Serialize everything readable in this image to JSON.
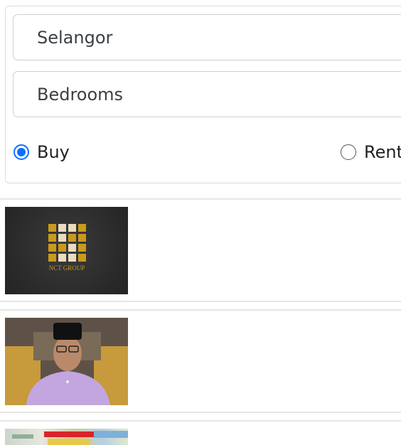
{
  "filters": {
    "region": {
      "value": "Selangor"
    },
    "bedrooms": {
      "value": "Bedrooms"
    },
    "listing_type": {
      "options": [
        {
          "label": "Buy",
          "checked": true
        },
        {
          "label": "Rent",
          "checked": false
        }
      ]
    }
  },
  "results": [
    {
      "image": "nct-group-logo",
      "logo_text": "NCT GROUP"
    },
    {
      "image": "man-in-songkok-portrait"
    },
    {
      "image": "shop-signboards-photo"
    }
  ],
  "colors": {
    "accent": "#0d6efd",
    "border": "#cfcfcf"
  }
}
